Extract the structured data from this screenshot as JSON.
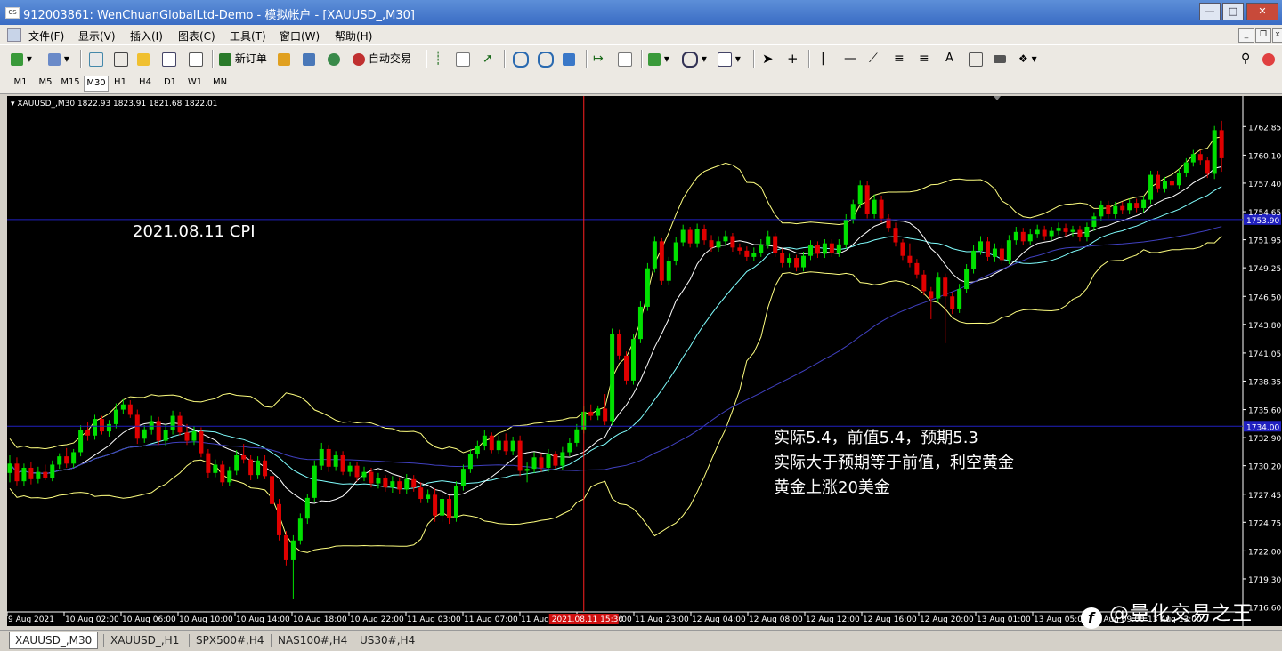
{
  "window": {
    "title": "912003861: WenChuanGlobalLtd-Demo - 模拟帐户 - [XAUUSD_,M30]",
    "icon_text": "CS"
  },
  "menu": [
    "文件(F)",
    "显示(V)",
    "插入(I)",
    "图表(C)",
    "工具(T)",
    "窗口(W)",
    "帮助(H)"
  ],
  "toolbar": {
    "new_order": "新订单",
    "auto_trade": "自动交易"
  },
  "timeframes": [
    "M1",
    "M5",
    "M15",
    "M30",
    "H1",
    "H4",
    "D1",
    "W1",
    "MN"
  ],
  "active_timeframe": "M30",
  "chart_header": "XAUUSD_,M30  1822.93 1823.91 1821.68 1822.01",
  "annotations": {
    "title": "2021.08.11  CPI",
    "line1": "实际5.4，前值5.4，预期5.3",
    "line2": "实际大于预期等于前值，利空黄金",
    "line3": "黄金上涨20美金"
  },
  "bottom_tabs": [
    "XAUUSD_,M30",
    "XAUUSD_,H1",
    "SPX500#,H4",
    "NAS100#,H4",
    "US30#,H4"
  ],
  "watermark": "@量化交易之王",
  "colors": {
    "bull": "#00e000",
    "bear": "#e00000",
    "bands": "#ffff80",
    "ma_fast": "#ffffff",
    "ma_mid": "#80ffff",
    "ma_slow": "#4040c0",
    "hline": "#2020c0",
    "vline": "#ff2020"
  },
  "chart_data": {
    "type": "candlestick",
    "symbol": "XAUUSD_",
    "timeframe": "M30",
    "ylim": [
      1716.3,
      1765.1
    ],
    "y_ticks": [
      "1762.85",
      "1760.10",
      "1757.40",
      "1754.65",
      "1751.95",
      "1749.25",
      "1746.50",
      "1743.80",
      "1741.05",
      "1738.35",
      "1735.60",
      "1732.90",
      "1730.20",
      "1727.45",
      "1724.75",
      "1722.00",
      "1719.30",
      "1716.60"
    ],
    "x_ticks": [
      "9 Aug 2021",
      "10 Aug 02:00",
      "10 Aug 06:00",
      "10 Aug 10:00",
      "10 Aug 14:00",
      "10 Aug 18:00",
      "10 Aug 22:00",
      "11 Aug 03:00",
      "11 Aug 07:00",
      "11 Aug",
      "11 Aug 19:00",
      "11 Aug 23:00",
      "12 Aug 04:00",
      "12 Aug 08:00",
      "12 Aug 12:00",
      "12 Aug 16:00",
      "12 Aug 20:00",
      "13 Aug 01:00",
      "13 Aug 05:00",
      "13 Aug 09:00",
      "13 Aug 13:00"
    ],
    "highlight_time": "2021.08.11 15:30",
    "horizontal_lines": [
      {
        "price": 1753.9,
        "label": "1753.90"
      },
      {
        "price": 1734.0,
        "label": "1734.00"
      }
    ],
    "vertical_line_time": "2021.08.11 15:30",
    "candles": [
      [
        1729.5,
        1731.2,
        1728.6,
        1730.4
      ],
      [
        1730.4,
        1731.0,
        1728.3,
        1728.7
      ],
      [
        1728.7,
        1730.4,
        1728.2,
        1730.0
      ],
      [
        1730.0,
        1730.6,
        1728.4,
        1728.9
      ],
      [
        1728.9,
        1730.1,
        1728.5,
        1729.6
      ],
      [
        1729.6,
        1730.3,
        1728.8,
        1729.0
      ],
      [
        1729.0,
        1730.7,
        1728.7,
        1730.3
      ],
      [
        1730.3,
        1731.4,
        1729.9,
        1731.1
      ],
      [
        1731.1,
        1731.9,
        1730.0,
        1730.4
      ],
      [
        1730.4,
        1731.8,
        1730.0,
        1731.5
      ],
      [
        1731.5,
        1734.1,
        1731.1,
        1733.6
      ],
      [
        1733.6,
        1734.4,
        1732.6,
        1733.1
      ],
      [
        1733.1,
        1735.1,
        1732.7,
        1734.7
      ],
      [
        1734.7,
        1735.0,
        1733.2,
        1733.5
      ],
      [
        1733.5,
        1734.6,
        1733.0,
        1734.2
      ],
      [
        1734.2,
        1736.2,
        1733.8,
        1735.6
      ],
      [
        1735.6,
        1736.6,
        1735.2,
        1736.1
      ],
      [
        1736.1,
        1736.5,
        1734.8,
        1735.1
      ],
      [
        1735.1,
        1735.6,
        1732.3,
        1732.8
      ],
      [
        1732.8,
        1734.1,
        1732.4,
        1733.7
      ],
      [
        1733.7,
        1735.0,
        1733.2,
        1734.5
      ],
      [
        1734.5,
        1734.9,
        1732.2,
        1732.6
      ],
      [
        1732.6,
        1734.2,
        1732.1,
        1733.6
      ],
      [
        1733.6,
        1735.5,
        1733.2,
        1735.0
      ],
      [
        1735.0,
        1735.4,
        1733.1,
        1733.4
      ],
      [
        1733.4,
        1734.2,
        1732.2,
        1732.6
      ],
      [
        1732.6,
        1734.0,
        1732.2,
        1733.5
      ],
      [
        1733.5,
        1733.9,
        1731.0,
        1731.4
      ],
      [
        1731.4,
        1731.8,
        1729.0,
        1729.5
      ],
      [
        1729.5,
        1730.8,
        1729.1,
        1730.3
      ],
      [
        1730.3,
        1730.7,
        1728.2,
        1728.6
      ],
      [
        1728.6,
        1730.1,
        1728.2,
        1729.7
      ],
      [
        1729.7,
        1731.7,
        1729.3,
        1731.2
      ],
      [
        1731.2,
        1732.3,
        1730.4,
        1730.8
      ],
      [
        1730.8,
        1731.2,
        1728.8,
        1729.3
      ],
      [
        1729.3,
        1731.1,
        1728.9,
        1730.7
      ],
      [
        1730.7,
        1731.2,
        1728.9,
        1729.2
      ],
      [
        1729.2,
        1729.7,
        1726.0,
        1726.5
      ],
      [
        1726.5,
        1727.0,
        1723.0,
        1723.5
      ],
      [
        1723.5,
        1723.9,
        1720.6,
        1721.1
      ],
      [
        1721.1,
        1723.5,
        1717.4,
        1723.0
      ],
      [
        1723.0,
        1725.6,
        1722.6,
        1725.1
      ],
      [
        1725.1,
        1727.5,
        1724.6,
        1727.1
      ],
      [
        1727.1,
        1730.7,
        1726.7,
        1730.2
      ],
      [
        1730.2,
        1732.4,
        1729.8,
        1731.8
      ],
      [
        1731.8,
        1732.2,
        1729.6,
        1730.1
      ],
      [
        1730.1,
        1731.6,
        1729.7,
        1731.2
      ],
      [
        1731.2,
        1731.6,
        1729.3,
        1729.6
      ],
      [
        1729.6,
        1730.6,
        1729.2,
        1730.2
      ],
      [
        1730.2,
        1730.6,
        1728.7,
        1729.1
      ],
      [
        1729.1,
        1730.1,
        1728.7,
        1729.6
      ],
      [
        1729.6,
        1730.0,
        1728.1,
        1728.5
      ],
      [
        1728.5,
        1729.5,
        1728.0,
        1729.0
      ],
      [
        1729.0,
        1729.3,
        1727.7,
        1728.1
      ],
      [
        1728.1,
        1729.2,
        1727.6,
        1728.7
      ],
      [
        1728.7,
        1729.1,
        1727.5,
        1727.9
      ],
      [
        1727.9,
        1729.4,
        1727.5,
        1728.9
      ],
      [
        1728.9,
        1729.3,
        1727.7,
        1728.1
      ],
      [
        1728.1,
        1728.6,
        1726.6,
        1727.0
      ],
      [
        1727.0,
        1727.9,
        1726.6,
        1727.4
      ],
      [
        1727.4,
        1728.0,
        1724.8,
        1725.4
      ],
      [
        1725.4,
        1727.5,
        1724.8,
        1727.0
      ],
      [
        1727.0,
        1727.3,
        1724.6,
        1725.2
      ],
      [
        1725.2,
        1728.7,
        1724.8,
        1728.2
      ],
      [
        1728.2,
        1730.3,
        1727.8,
        1729.9
      ],
      [
        1729.9,
        1731.8,
        1729.5,
        1731.3
      ],
      [
        1731.3,
        1732.6,
        1730.9,
        1732.1
      ],
      [
        1732.1,
        1733.6,
        1731.7,
        1733.1
      ],
      [
        1733.1,
        1733.4,
        1731.4,
        1731.7
      ],
      [
        1731.7,
        1733.1,
        1731.3,
        1732.6
      ],
      [
        1732.6,
        1733.3,
        1731.2,
        1731.6
      ],
      [
        1731.6,
        1733.0,
        1731.2,
        1732.6
      ],
      [
        1732.6,
        1733.1,
        1729.2,
        1729.7
      ],
      [
        1729.7,
        1730.5,
        1728.6,
        1729.9
      ],
      [
        1729.9,
        1731.5,
        1729.5,
        1731.0
      ],
      [
        1731.0,
        1731.4,
        1729.6,
        1730.0
      ],
      [
        1730.0,
        1731.8,
        1729.6,
        1731.3
      ],
      [
        1731.3,
        1731.6,
        1729.9,
        1730.2
      ],
      [
        1730.2,
        1732.0,
        1729.8,
        1731.5
      ],
      [
        1731.5,
        1732.9,
        1731.1,
        1732.4
      ],
      [
        1732.4,
        1734.2,
        1732.0,
        1733.7
      ],
      [
        1733.7,
        1735.9,
        1733.3,
        1735.4
      ],
      [
        1735.4,
        1736.1,
        1734.6,
        1735.0
      ],
      [
        1735.0,
        1736.0,
        1734.6,
        1735.7
      ],
      [
        1735.7,
        1737.1,
        1734.1,
        1734.5
      ],
      [
        1734.5,
        1743.4,
        1734.1,
        1742.9
      ],
      [
        1742.9,
        1743.3,
        1740.4,
        1740.8
      ],
      [
        1740.8,
        1741.2,
        1738.0,
        1738.4
      ],
      [
        1738.4,
        1742.9,
        1738.0,
        1742.4
      ],
      [
        1742.4,
        1746.0,
        1742.0,
        1745.5
      ],
      [
        1745.5,
        1749.7,
        1745.1,
        1749.2
      ],
      [
        1749.2,
        1752.3,
        1748.8,
        1751.8
      ],
      [
        1751.8,
        1752.1,
        1747.6,
        1748.0
      ],
      [
        1748.0,
        1750.3,
        1747.6,
        1749.9
      ],
      [
        1749.9,
        1752.2,
        1749.5,
        1751.7
      ],
      [
        1751.7,
        1753.4,
        1751.3,
        1752.9
      ],
      [
        1752.9,
        1753.2,
        1751.2,
        1751.6
      ],
      [
        1751.6,
        1753.5,
        1751.2,
        1753.0
      ],
      [
        1753.0,
        1753.4,
        1751.5,
        1751.9
      ],
      [
        1751.9,
        1752.4,
        1750.8,
        1751.2
      ],
      [
        1751.2,
        1752.3,
        1750.8,
        1751.8
      ],
      [
        1751.8,
        1752.8,
        1751.4,
        1752.3
      ],
      [
        1752.3,
        1752.6,
        1750.8,
        1751.2
      ],
      [
        1751.2,
        1751.6,
        1750.5,
        1750.9
      ],
      [
        1750.9,
        1751.3,
        1749.9,
        1750.3
      ],
      [
        1750.3,
        1751.2,
        1749.9,
        1750.7
      ],
      [
        1750.7,
        1752.0,
        1750.3,
        1751.5
      ],
      [
        1751.5,
        1752.8,
        1751.1,
        1752.3
      ],
      [
        1752.3,
        1752.6,
        1750.3,
        1750.7
      ],
      [
        1750.7,
        1751.1,
        1749.3,
        1749.7
      ],
      [
        1749.7,
        1750.6,
        1749.3,
        1750.2
      ],
      [
        1750.2,
        1750.5,
        1748.9,
        1749.3
      ],
      [
        1749.3,
        1750.8,
        1748.9,
        1750.4
      ],
      [
        1750.4,
        1751.9,
        1750.0,
        1751.4
      ],
      [
        1751.4,
        1751.8,
        1750.2,
        1750.6
      ],
      [
        1750.6,
        1752.0,
        1750.2,
        1751.6
      ],
      [
        1751.6,
        1752.0,
        1750.3,
        1750.7
      ],
      [
        1750.7,
        1752.0,
        1750.3,
        1751.5
      ],
      [
        1751.5,
        1754.4,
        1751.1,
        1753.9
      ],
      [
        1753.9,
        1755.8,
        1753.5,
        1755.4
      ],
      [
        1755.4,
        1757.7,
        1755.0,
        1757.2
      ],
      [
        1757.2,
        1757.6,
        1754.0,
        1754.4
      ],
      [
        1754.4,
        1756.3,
        1754.0,
        1755.8
      ],
      [
        1755.8,
        1756.2,
        1753.6,
        1754.0
      ],
      [
        1754.0,
        1754.4,
        1752.7,
        1753.1
      ],
      [
        1753.1,
        1753.6,
        1751.3,
        1751.7
      ],
      [
        1751.7,
        1752.0,
        1750.0,
        1750.4
      ],
      [
        1750.4,
        1751.6,
        1749.3,
        1749.7
      ],
      [
        1749.7,
        1750.1,
        1748.2,
        1748.6
      ],
      [
        1748.6,
        1749.0,
        1746.6,
        1747.0
      ],
      [
        1747.0,
        1747.4,
        1744.3,
        1746.3
      ],
      [
        1746.3,
        1748.8,
        1745.9,
        1748.3
      ],
      [
        1748.3,
        1748.7,
        1742.0,
        1746.5
      ],
      [
        1746.5,
        1746.9,
        1744.8,
        1745.3
      ],
      [
        1745.3,
        1747.7,
        1744.9,
        1747.2
      ],
      [
        1747.2,
        1749.6,
        1746.8,
        1749.1
      ],
      [
        1749.1,
        1751.4,
        1748.7,
        1750.9
      ],
      [
        1750.9,
        1752.3,
        1750.5,
        1751.8
      ],
      [
        1751.8,
        1752.2,
        1749.9,
        1750.3
      ],
      [
        1750.3,
        1751.6,
        1749.8,
        1751.1
      ],
      [
        1751.1,
        1751.5,
        1749.6,
        1750.0
      ],
      [
        1750.0,
        1752.4,
        1749.6,
        1751.9
      ],
      [
        1751.9,
        1753.2,
        1751.5,
        1752.7
      ],
      [
        1752.7,
        1753.1,
        1751.4,
        1751.8
      ],
      [
        1751.8,
        1753.0,
        1751.4,
        1752.5
      ],
      [
        1752.5,
        1753.4,
        1752.1,
        1752.9
      ],
      [
        1752.9,
        1753.3,
        1751.9,
        1752.3
      ],
      [
        1752.3,
        1753.2,
        1751.9,
        1752.8
      ],
      [
        1752.8,
        1753.6,
        1752.4,
        1753.1
      ],
      [
        1753.1,
        1753.5,
        1752.3,
        1752.7
      ],
      [
        1752.7,
        1753.3,
        1752.3,
        1752.9
      ],
      [
        1752.9,
        1753.3,
        1751.8,
        1752.2
      ],
      [
        1752.2,
        1753.6,
        1751.8,
        1753.2
      ],
      [
        1753.2,
        1754.6,
        1752.8,
        1754.2
      ],
      [
        1754.2,
        1755.7,
        1753.8,
        1755.3
      ],
      [
        1755.3,
        1755.7,
        1754.0,
        1754.4
      ],
      [
        1754.4,
        1755.6,
        1754.0,
        1755.2
      ],
      [
        1755.2,
        1755.6,
        1754.4,
        1754.8
      ],
      [
        1754.8,
        1755.9,
        1754.4,
        1755.5
      ],
      [
        1755.5,
        1755.9,
        1754.6,
        1755.0
      ],
      [
        1755.0,
        1756.2,
        1754.6,
        1755.8
      ],
      [
        1755.8,
        1758.6,
        1755.4,
        1758.2
      ],
      [
        1758.2,
        1758.6,
        1756.5,
        1756.9
      ],
      [
        1756.9,
        1758.0,
        1756.5,
        1757.6
      ],
      [
        1757.6,
        1758.0,
        1756.8,
        1757.2
      ],
      [
        1757.2,
        1758.8,
        1756.8,
        1758.4
      ],
      [
        1758.4,
        1759.8,
        1758.0,
        1759.4
      ],
      [
        1759.4,
        1760.6,
        1759.0,
        1760.2
      ],
      [
        1760.2,
        1760.6,
        1759.2,
        1759.6
      ],
      [
        1759.6,
        1759.9,
        1757.9,
        1758.3
      ],
      [
        1758.3,
        1762.9,
        1757.8,
        1762.5
      ],
      [
        1762.5,
        1763.4,
        1758.5,
        1759.8
      ]
    ]
  }
}
